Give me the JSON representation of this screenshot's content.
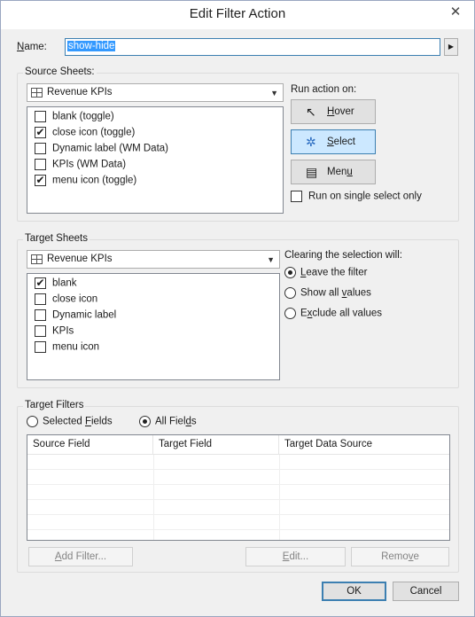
{
  "window": {
    "title": "Edit Filter Action",
    "close_glyph": "✕"
  },
  "name_field": {
    "label_prefix": "N",
    "label_rest": "ame:",
    "value": "show-hide",
    "menu_glyph": "▶"
  },
  "source_sheets": {
    "title": "Source Sheets:",
    "combo_value": "Revenue KPIs",
    "items": [
      {
        "label": "blank (toggle)",
        "checked": false
      },
      {
        "label": "close icon (toggle)",
        "checked": true
      },
      {
        "label": "Dynamic label (WM Data)",
        "checked": false
      },
      {
        "label": "KPIs (WM Data)",
        "checked": false
      },
      {
        "label": "menu icon (toggle)",
        "checked": true
      }
    ],
    "run_action_label": "Run action on:",
    "buttons": [
      {
        "label_u": "H",
        "label_rest": "over",
        "icon": "pointer-icon",
        "active": false
      },
      {
        "label_u": "S",
        "label_rest": "elect",
        "icon": "select-click-icon",
        "active": true
      },
      {
        "label_pre": "Men",
        "label_u": "u",
        "label_rest": "",
        "icon": "menu-icon",
        "active": false
      }
    ],
    "single_select_label": "Run on single select only",
    "single_select_checked": false
  },
  "target_sheets": {
    "title": "Target Sheets",
    "combo_value": "Revenue KPIs",
    "items": [
      {
        "label": "blank",
        "checked": true
      },
      {
        "label": "close icon",
        "checked": false
      },
      {
        "label": "Dynamic label",
        "checked": false
      },
      {
        "label": "KPIs",
        "checked": false
      },
      {
        "label": "menu icon",
        "checked": false
      }
    ],
    "clearing_label": "Clearing the selection will:",
    "options": [
      {
        "pre": "",
        "u": "L",
        "rest": "eave the filter",
        "selected": true
      },
      {
        "pre": "Show all ",
        "u": "v",
        "rest": "alues",
        "selected": false
      },
      {
        "pre": "E",
        "u": "x",
        "rest": "clude all values",
        "selected": false
      }
    ]
  },
  "target_filters": {
    "title": "Target Filters",
    "scope_options": [
      {
        "pre": "Selected ",
        "u": "F",
        "rest": "ields",
        "selected": false
      },
      {
        "pre": "All Fiel",
        "u": "d",
        "rest": "s",
        "selected": true
      }
    ],
    "columns": [
      "Source Field",
      "Target Field",
      "Target Data Source"
    ],
    "add_filter": {
      "u": "A",
      "rest": "dd Filter..."
    },
    "edit": {
      "u": "E",
      "rest": "dit..."
    },
    "remove": {
      "pre": "Remo",
      "u": "v",
      "rest": "e"
    }
  },
  "footer": {
    "ok": "OK",
    "cancel": "Cancel"
  },
  "colors": {
    "accent": "#3c7fb1",
    "selected_button": "#cce8ff",
    "selection_highlight": "#3399ff"
  }
}
